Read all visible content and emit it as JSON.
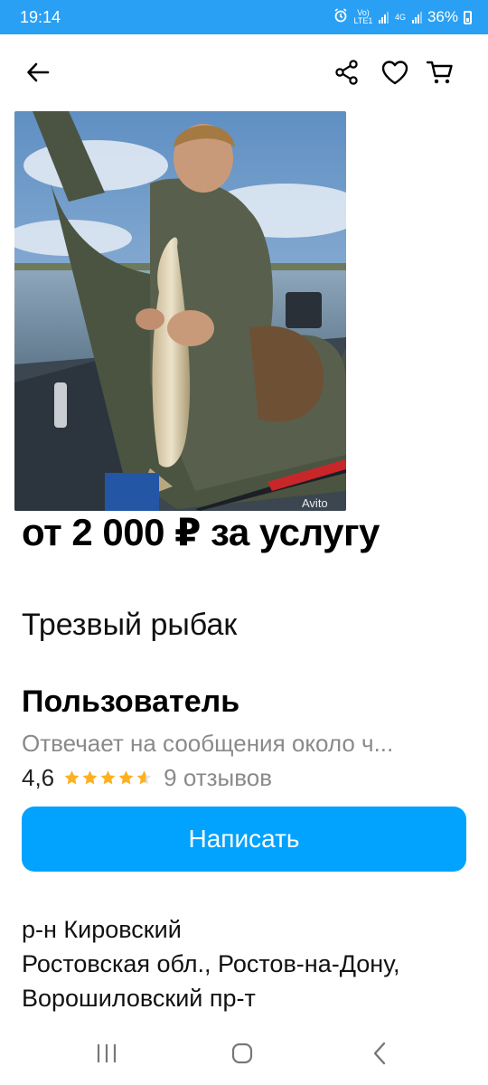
{
  "status_bar": {
    "time": "19:14",
    "net_1": "Vo) LTE1",
    "net_2": "4G",
    "battery": "36%"
  },
  "topbar": {
    "back_icon": "arrow-left-icon",
    "share_icon": "share-icon",
    "favorite_icon": "heart-icon",
    "cart_icon": "cart-icon"
  },
  "listing": {
    "photo_watermark": "Avito",
    "price": "от 2 000 ₽ за услугу",
    "title": "Трезвый рыбак"
  },
  "seller": {
    "name": "Пользователь",
    "reply_time": "Отвечает на сообщения около ч...",
    "rating": "4,6",
    "stars": 4.6,
    "reviews": "9 отзывов",
    "write_button": "Написать"
  },
  "location": {
    "district": "р-н Кировский",
    "address": "Ростовская обл., Ростов-на-Дону, Ворошиловский пр-т"
  },
  "colors": {
    "status_bar": "#2aa0f4",
    "accent_button": "#02a2ff",
    "star": "#ffb01f"
  }
}
